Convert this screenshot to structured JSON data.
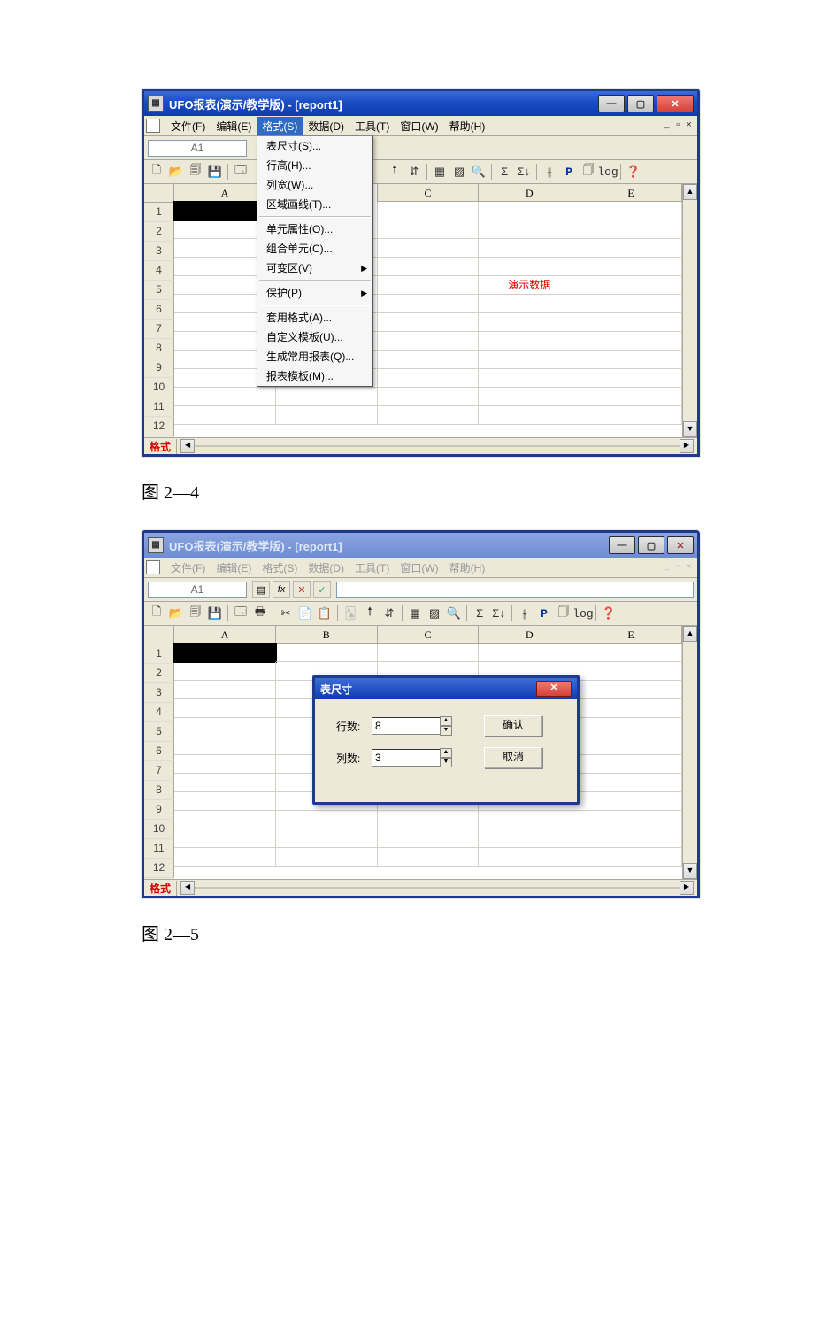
{
  "captions": {
    "fig1": "图 2—4",
    "fig2": "图 2—5"
  },
  "window1": {
    "title": "UFO报表(演示/教学版) - [report1]",
    "menu": {
      "file": "文件(F)",
      "edit": "编辑(E)",
      "format": "格式(S)",
      "data": "数据(D)",
      "tool": "工具(T)",
      "window": "窗口(W)",
      "help": "帮助(H)"
    },
    "cellref": "A1",
    "columns": [
      "A",
      "B",
      "C",
      "D",
      "E"
    ],
    "rows": [
      "1",
      "2",
      "3",
      "4",
      "5",
      "6",
      "7",
      "8",
      "9",
      "10",
      "11",
      "12"
    ],
    "demo_text": "演示数据",
    "status_tag": "格式",
    "dropdown": {
      "group1": [
        "表尺寸(S)...",
        "行高(H)...",
        "列宽(W)...",
        "区域画线(T)..."
      ],
      "group2": [
        "单元属性(O)...",
        "组合单元(C)...",
        "可变区(V)"
      ],
      "group3": [
        "保护(P)"
      ],
      "group4": [
        "套用格式(A)...",
        "自定义模板(U)...",
        "生成常用报表(Q)...",
        "报表模板(M)..."
      ]
    },
    "toolbar_icons": [
      "🗋",
      "📂",
      "🗐",
      "💾",
      "",
      "🖶",
      "",
      "✂",
      "📋",
      "📋",
      "",
      "|",
      "🠕",
      "⇵",
      "",
      "▦",
      "▨",
      "🔍",
      "",
      "Σ",
      "Σ↓",
      "",
      "⫳",
      "P",
      "🗍",
      "log",
      "❓"
    ]
  },
  "window2": {
    "title": "UFO报表(演示/教学版) - [report1]",
    "menu": {
      "file": "文件(F)",
      "edit": "编辑(E)",
      "format": "格式(S)",
      "data": "数据(D)",
      "tool": "工具(T)",
      "window": "窗口(W)",
      "help": "帮助(H)"
    },
    "cellref": "A1",
    "fx": {
      "insert": "▤",
      "fx": "fx",
      "cancel": "✕",
      "ok": "✓"
    },
    "columns": [
      "A",
      "B",
      "C",
      "D",
      "E"
    ],
    "rows": [
      "1",
      "2",
      "3",
      "4",
      "5",
      "6",
      "7",
      "8",
      "9",
      "10",
      "11",
      "12"
    ],
    "status_tag": "格式",
    "dialog": {
      "title": "表尺寸",
      "rows_label": "行数:",
      "rows_value": "8",
      "cols_label": "列数:",
      "cols_value": "3",
      "ok": "确认",
      "cancel": "取消",
      "close": "✕"
    }
  },
  "toolbar": {
    "new": "🗋",
    "open": "📂",
    "copybook": "🗐",
    "save": "💾",
    "preview": "🗔",
    "print": "🖶",
    "cut": "✂",
    "copy": "📄",
    "paste": "📋",
    "game": "🂡",
    "arrow": "🠕",
    "sort": "⇵",
    "grid": "▦",
    "chart": "▨",
    "find": "🔍",
    "sum": "Σ",
    "sumsort": "Σ↓",
    "path": "⫳",
    "P": "P",
    "page": "🗍",
    "log": "log",
    "help": "❓"
  }
}
